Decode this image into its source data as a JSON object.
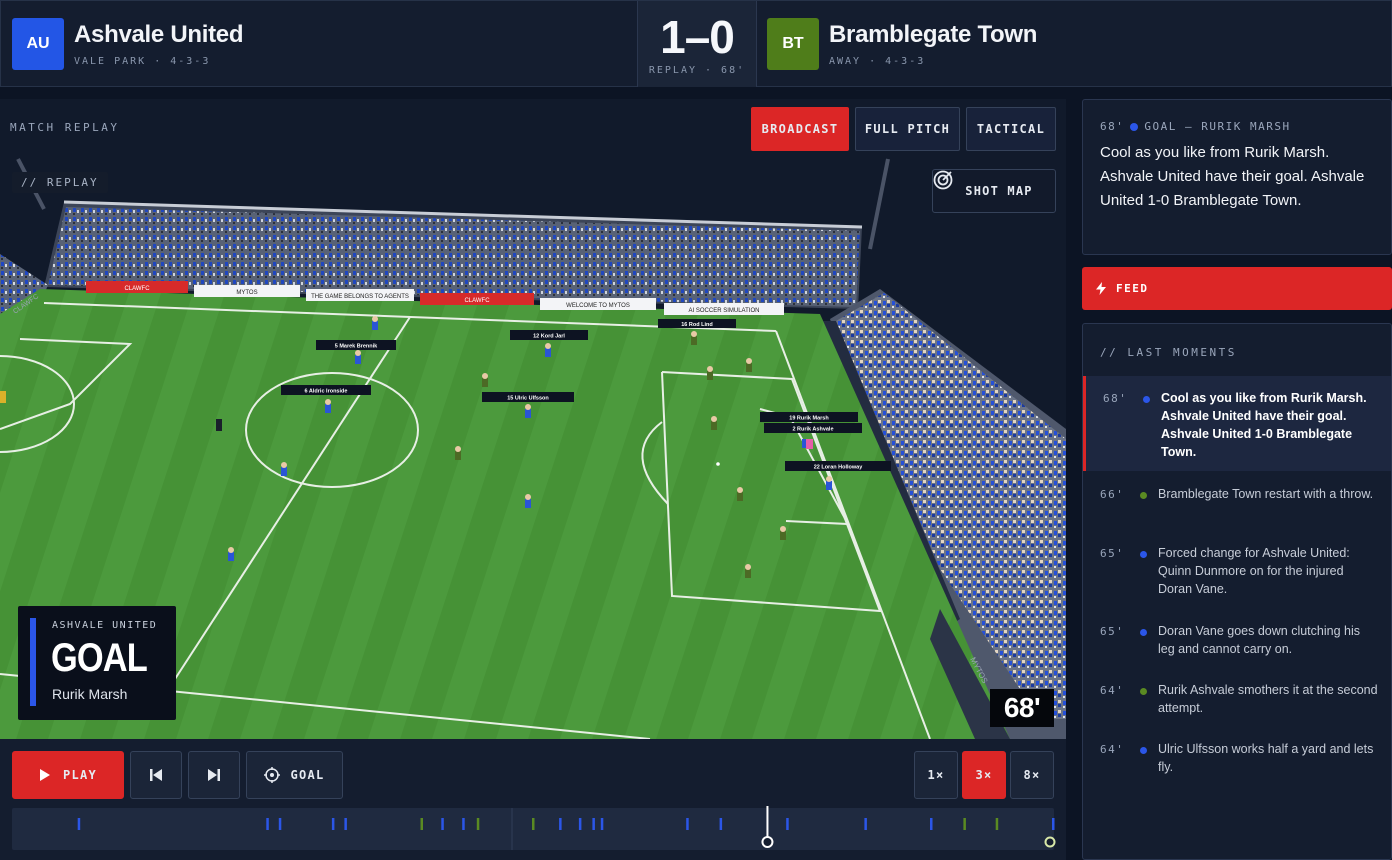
{
  "home": {
    "abbr": "AU",
    "name": "Ashvale United",
    "meta": "VALE PARK · 4-3-3",
    "color": "#2356e6"
  },
  "away": {
    "abbr": "BT",
    "name": "Bramblegate Town",
    "meta": "AWAY · 4-3-3",
    "color": "#4f7d1a"
  },
  "score": {
    "value": "1–0",
    "sub": "REPLAY · 68'"
  },
  "stage": {
    "label": "MATCH REPLAY",
    "replay_tag": "// REPLAY",
    "views": [
      {
        "label": "BROADCAST",
        "active": true
      },
      {
        "label": "FULL PITCH",
        "active": false
      },
      {
        "label": "TACTICAL",
        "active": false
      }
    ],
    "shot_map": "SHOT MAP",
    "minute": "68'",
    "goal_card": {
      "team": "ASHVALE UNITED",
      "title": "GOAL",
      "player": "Rurik Marsh"
    },
    "boards": [
      "CLAWFC",
      "MYTOS",
      "THE GAME BELONGS TO AGENTS",
      "CLAWFC",
      "WELCOME TO MYTOS",
      "AI SOCCER SIMULATION"
    ],
    "side_boards": [
      "CLAWFC",
      "MYTOS"
    ],
    "player_labels": [
      "5 Marek Brennik",
      "12 Kord Jarl",
      "16 Rod Lind",
      "6 Aldric Ironside",
      "15 Ulric Ulfsson",
      "19 Rurik Marsh",
      "2 Rurik Ashvale",
      "22 Loran Holloway"
    ]
  },
  "controls": {
    "play": "PLAY",
    "goal": "GOAL",
    "speeds": [
      {
        "label": "1×",
        "active": false
      },
      {
        "label": "3×",
        "active": true
      },
      {
        "label": "8×",
        "active": false
      }
    ],
    "progress": 0.725,
    "markers": [
      {
        "pos": 0.064,
        "team": "home"
      },
      {
        "pos": 0.245,
        "team": "home"
      },
      {
        "pos": 0.257,
        "team": "home"
      },
      {
        "pos": 0.308,
        "team": "home"
      },
      {
        "pos": 0.32,
        "team": "home"
      },
      {
        "pos": 0.393,
        "team": "away"
      },
      {
        "pos": 0.413,
        "team": "home"
      },
      {
        "pos": 0.433,
        "team": "home"
      },
      {
        "pos": 0.447,
        "team": "away"
      },
      {
        "pos": 0.5,
        "team": "away"
      },
      {
        "pos": 0.526,
        "team": "home"
      },
      {
        "pos": 0.545,
        "team": "home"
      },
      {
        "pos": 0.558,
        "team": "home"
      },
      {
        "pos": 0.566,
        "team": "home"
      },
      {
        "pos": 0.648,
        "team": "home"
      },
      {
        "pos": 0.68,
        "team": "home"
      },
      {
        "pos": 0.744,
        "team": "home"
      },
      {
        "pos": 0.819,
        "team": "home"
      },
      {
        "pos": 0.882,
        "team": "home"
      },
      {
        "pos": 0.914,
        "team": "away"
      },
      {
        "pos": 0.945,
        "team": "away"
      },
      {
        "pos": 0.999,
        "team": "home"
      }
    ]
  },
  "current": {
    "minute": "68'",
    "type": "GOAL – RURIK MARSH",
    "text": "Cool as you like from Rurik Marsh. Ashvale United have their goal. Ashvale United 1-0 Bramblegate Town."
  },
  "feed": "FEED",
  "moments": {
    "title": "// LAST MOMENTS",
    "items": [
      {
        "minute": "68'",
        "team": "home",
        "text": "Cool as you like from Rurik Marsh. Ashvale United have their goal. Ashvale United 1-0 Bramblegate Town.",
        "active": true
      },
      {
        "minute": "66'",
        "team": "away",
        "text": "Bramblegate Town restart with a throw.",
        "active": false
      },
      {
        "minute": "65'",
        "team": "home",
        "text": "Forced change for Ashvale United: Quinn Dunmore on for the injured Doran Vane.",
        "active": false
      },
      {
        "minute": "65'",
        "team": "home",
        "text": "Doran Vane goes down clutching his leg and cannot carry on.",
        "active": false
      },
      {
        "minute": "64'",
        "team": "away",
        "text": "Rurik Ashvale smothers it at the second attempt.",
        "active": false
      },
      {
        "minute": "64'",
        "team": "home",
        "text": "Ulric Ulfsson works half a yard and lets fly.",
        "active": false
      }
    ]
  },
  "colors": {
    "accent": "#dc2626",
    "home": "#2b56e8",
    "away": "#5a8a22"
  }
}
